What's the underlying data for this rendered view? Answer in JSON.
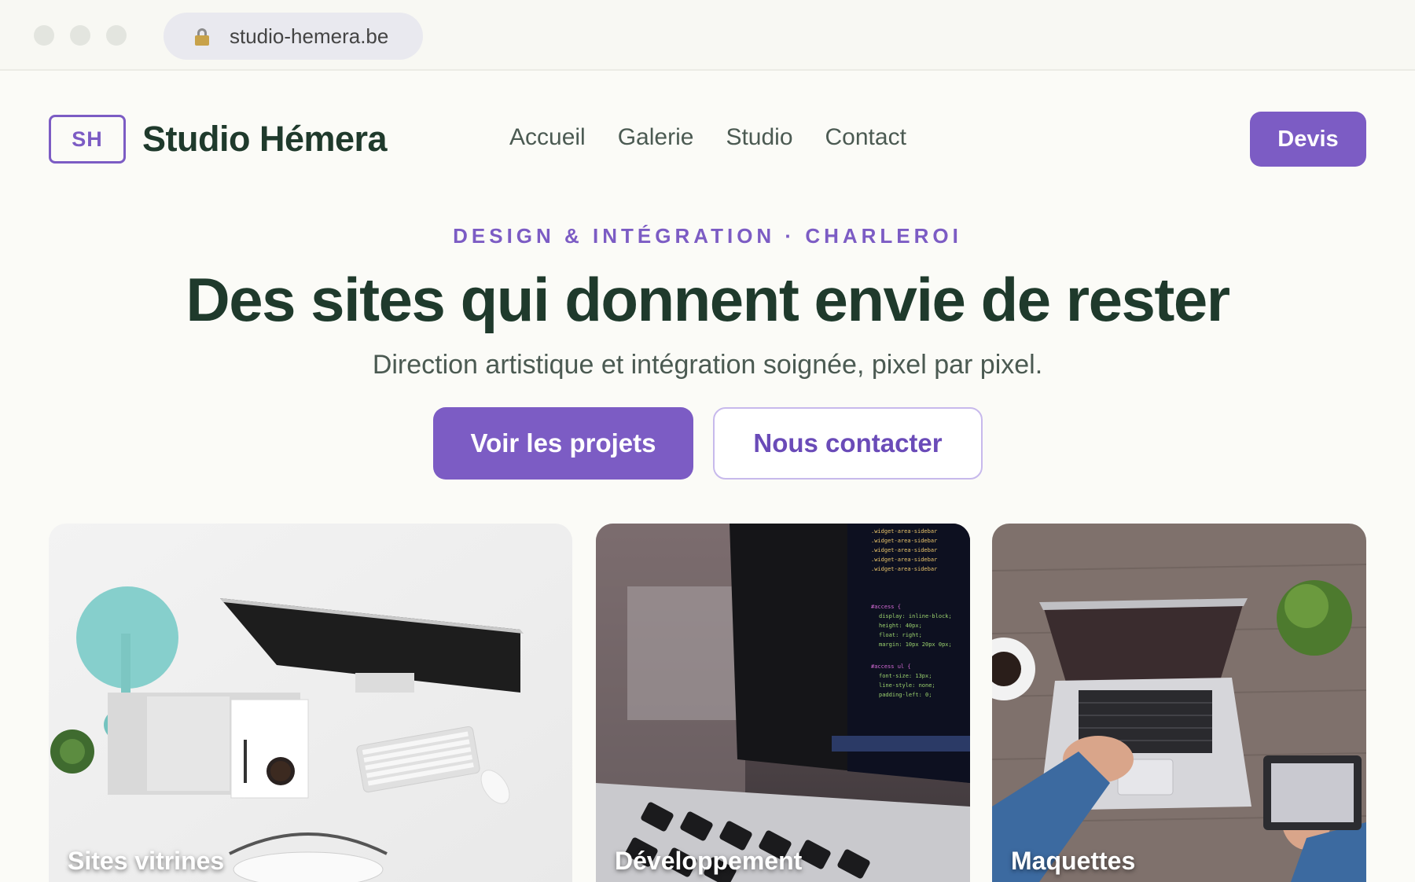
{
  "browser": {
    "url": "studio-hemera.be"
  },
  "header": {
    "logo_text": "SH",
    "brand": "Studio Hémera",
    "nav": [
      "Accueil",
      "Galerie",
      "Studio",
      "Contact"
    ],
    "cta": "Devis"
  },
  "hero": {
    "eyebrow": "DESIGN & INTÉGRATION · CHARLEROI",
    "title": "Des sites qui donnent envie de rester",
    "subtitle": "Direction artistique et intégration soignée, pixel par pixel.",
    "primary_button": "Voir les projets",
    "secondary_button": "Nous contacter"
  },
  "cards": [
    {
      "label": "Sites vitrines"
    },
    {
      "label": "Développement"
    },
    {
      "label": "Maquettes"
    }
  ],
  "colors": {
    "accent": "#7c5cc4",
    "text": "#1f3a2c",
    "background": "#fbfbf7"
  }
}
